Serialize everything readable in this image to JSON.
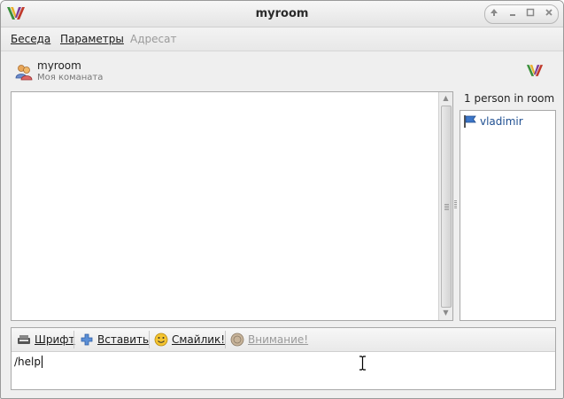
{
  "window": {
    "title": "myroom"
  },
  "menu": {
    "items": [
      {
        "label": "Беседа"
      },
      {
        "label": "Параметры"
      },
      {
        "label": "Адресат",
        "disabled": true
      }
    ]
  },
  "room": {
    "name": "myroom",
    "description": "Моя команата"
  },
  "occupants": {
    "title": "1 person in room",
    "list": [
      {
        "name": "vladimir"
      }
    ]
  },
  "toolbar": {
    "font_label": "Шрифт",
    "insert_label": "Вставить",
    "smiley_label": "Смайлик!",
    "attention_label": "Внимание!"
  },
  "message_input": {
    "value": "/help"
  },
  "colors": {
    "link_blue": "#1f4f91",
    "disabled_gray": "#9a9a9a"
  }
}
